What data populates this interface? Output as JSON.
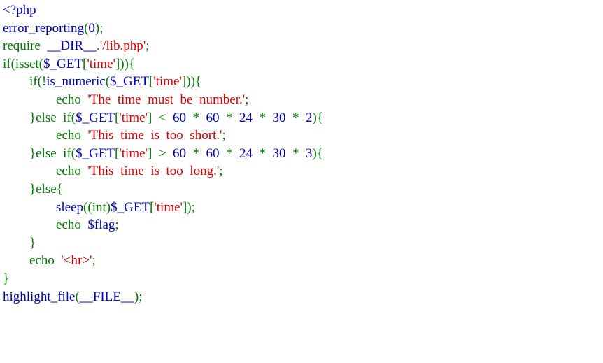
{
  "colors": {
    "default": "#0000BB",
    "keyword": "#007700",
    "string": "#DD0000",
    "background": "#FFFFFF"
  },
  "code_lines": [
    [
      {
        "t": "html",
        "s": "<?php"
      }
    ],
    [
      {
        "t": "default",
        "s": "error_reporting"
      },
      {
        "t": "keyword",
        "s": "("
      },
      {
        "t": "default",
        "s": "0"
      },
      {
        "t": "keyword",
        "s": ");"
      }
    ],
    [
      {
        "t": "keyword",
        "s": "require  "
      },
      {
        "t": "default",
        "s": "__DIR__"
      },
      {
        "t": "keyword",
        "s": "."
      },
      {
        "t": "string",
        "s": "'/lib.php'"
      },
      {
        "t": "keyword",
        "s": ";"
      }
    ],
    [
      {
        "t": "keyword",
        "s": "if(isset("
      },
      {
        "t": "default",
        "s": "$_GET"
      },
      {
        "t": "keyword",
        "s": "["
      },
      {
        "t": "string",
        "s": "'time'"
      },
      {
        "t": "keyword",
        "s": "])){"
      }
    ],
    [
      {
        "t": "keyword",
        "s": "        if(!"
      },
      {
        "t": "default",
        "s": "is_numeric"
      },
      {
        "t": "keyword",
        "s": "("
      },
      {
        "t": "default",
        "s": "$_GET"
      },
      {
        "t": "keyword",
        "s": "["
      },
      {
        "t": "string",
        "s": "'time'"
      },
      {
        "t": "keyword",
        "s": "])){"
      }
    ],
    [
      {
        "t": "keyword",
        "s": "                echo  "
      },
      {
        "t": "string",
        "s": "'The  time  must  be  number.'"
      },
      {
        "t": "keyword",
        "s": ";"
      }
    ],
    [
      {
        "t": "keyword",
        "s": "        }else  if("
      },
      {
        "t": "default",
        "s": "$_GET"
      },
      {
        "t": "keyword",
        "s": "["
      },
      {
        "t": "string",
        "s": "'time'"
      },
      {
        "t": "keyword",
        "s": "]  <  "
      },
      {
        "t": "default",
        "s": "60  "
      },
      {
        "t": "keyword",
        "s": "*  "
      },
      {
        "t": "default",
        "s": "60  "
      },
      {
        "t": "keyword",
        "s": "*  "
      },
      {
        "t": "default",
        "s": "24  "
      },
      {
        "t": "keyword",
        "s": "*  "
      },
      {
        "t": "default",
        "s": "30  "
      },
      {
        "t": "keyword",
        "s": "*  "
      },
      {
        "t": "default",
        "s": "2"
      },
      {
        "t": "keyword",
        "s": "){"
      }
    ],
    [
      {
        "t": "keyword",
        "s": "                echo  "
      },
      {
        "t": "string",
        "s": "'This  time  is  too  short.'"
      },
      {
        "t": "keyword",
        "s": ";"
      }
    ],
    [
      {
        "t": "keyword",
        "s": "        }else  if("
      },
      {
        "t": "default",
        "s": "$_GET"
      },
      {
        "t": "keyword",
        "s": "["
      },
      {
        "t": "string",
        "s": "'time'"
      },
      {
        "t": "keyword",
        "s": "]  >  "
      },
      {
        "t": "default",
        "s": "60  "
      },
      {
        "t": "keyword",
        "s": "*  "
      },
      {
        "t": "default",
        "s": "60  "
      },
      {
        "t": "keyword",
        "s": "*  "
      },
      {
        "t": "default",
        "s": "24  "
      },
      {
        "t": "keyword",
        "s": "*  "
      },
      {
        "t": "default",
        "s": "30  "
      },
      {
        "t": "keyword",
        "s": "*  "
      },
      {
        "t": "default",
        "s": "3"
      },
      {
        "t": "keyword",
        "s": "){"
      }
    ],
    [
      {
        "t": "keyword",
        "s": "                echo  "
      },
      {
        "t": "string",
        "s": "'This  time  is  too  long.'"
      },
      {
        "t": "keyword",
        "s": ";"
      }
    ],
    [
      {
        "t": "keyword",
        "s": "        }else{"
      }
    ],
    [
      {
        "t": "keyword",
        "s": "                "
      },
      {
        "t": "default",
        "s": "sleep"
      },
      {
        "t": "keyword",
        "s": "((int)"
      },
      {
        "t": "default",
        "s": "$_GET"
      },
      {
        "t": "keyword",
        "s": "["
      },
      {
        "t": "string",
        "s": "'time'"
      },
      {
        "t": "keyword",
        "s": "]);"
      }
    ],
    [
      {
        "t": "keyword",
        "s": "                echo  "
      },
      {
        "t": "default",
        "s": "$flag"
      },
      {
        "t": "keyword",
        "s": ";"
      }
    ],
    [
      {
        "t": "keyword",
        "s": "        }"
      }
    ],
    [
      {
        "t": "keyword",
        "s": "        echo  "
      },
      {
        "t": "string",
        "s": "'<hr>'"
      },
      {
        "t": "keyword",
        "s": ";"
      }
    ],
    [
      {
        "t": "keyword",
        "s": "}"
      }
    ],
    [
      {
        "t": "default",
        "s": "highlight_file"
      },
      {
        "t": "keyword",
        "s": "("
      },
      {
        "t": "default",
        "s": "__FILE__"
      },
      {
        "t": "keyword",
        "s": ");"
      }
    ]
  ]
}
